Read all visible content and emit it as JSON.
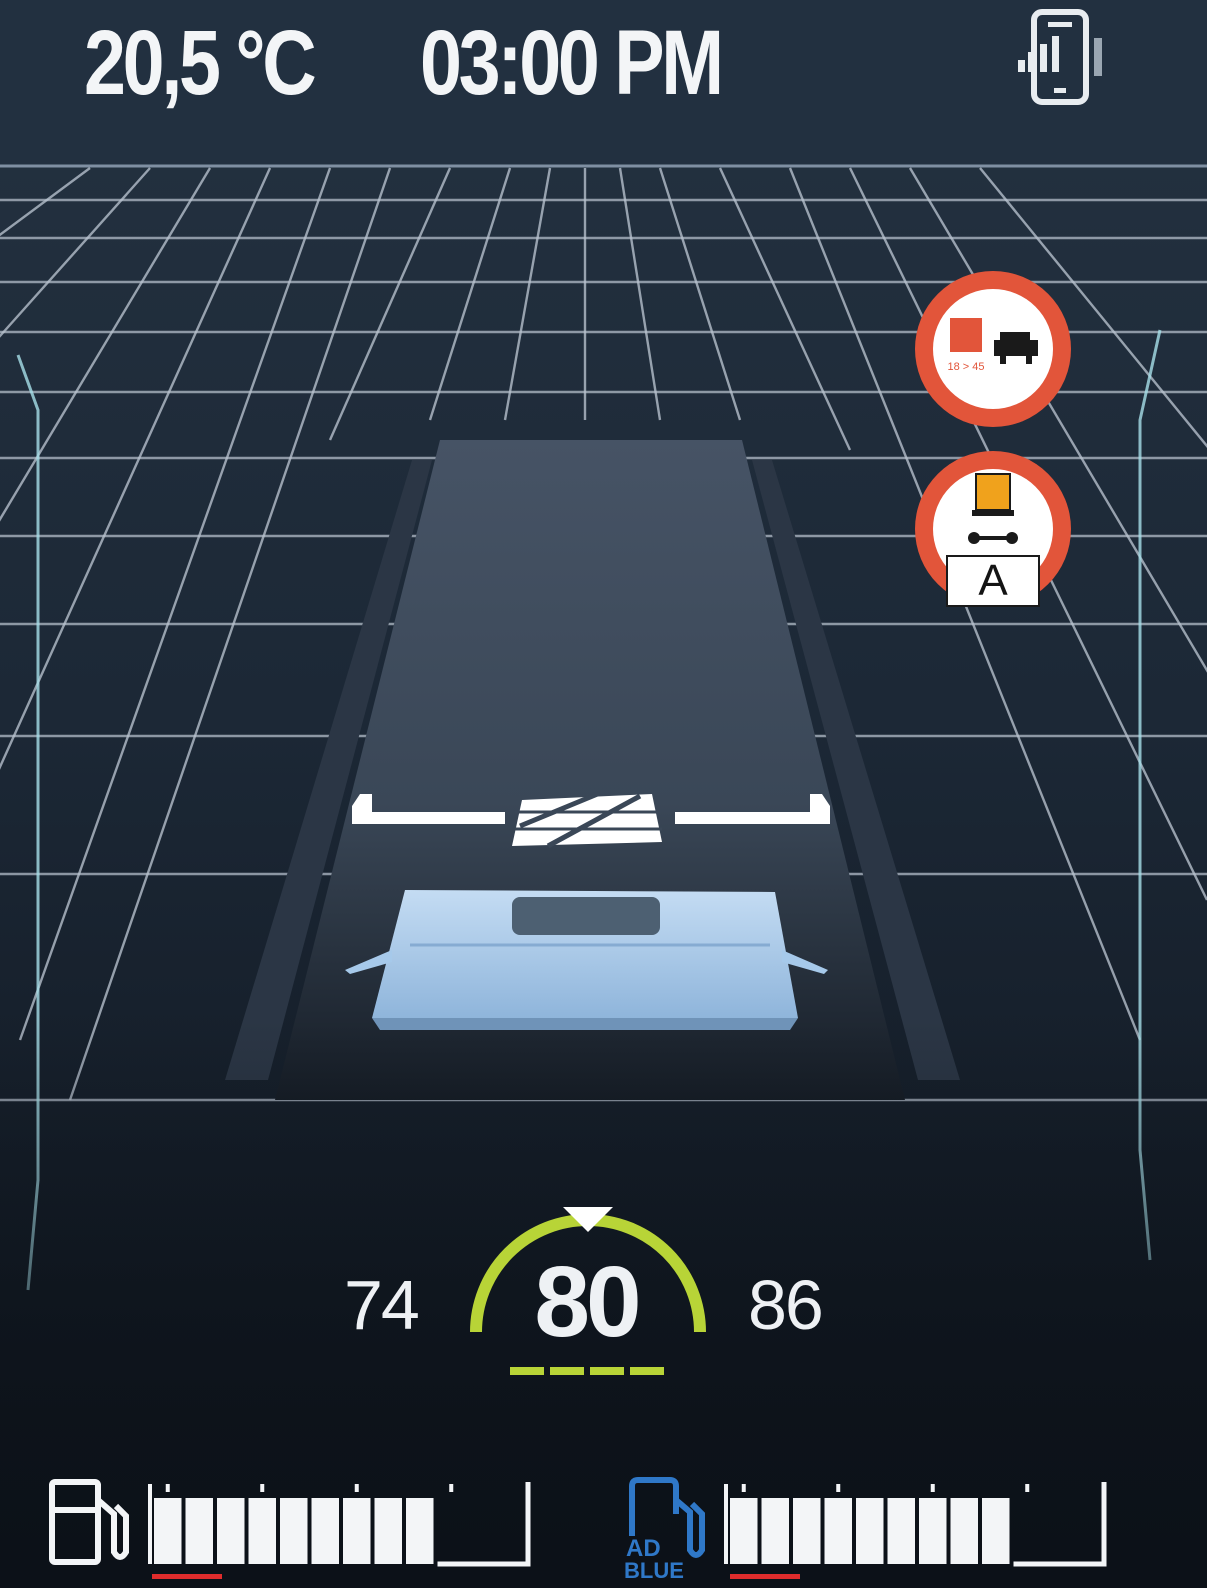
{
  "status_bar": {
    "temperature": "20,5 °C",
    "time": "03:00 PM",
    "connectivity_icon": "phone-signal-icon"
  },
  "traffic_signs": {
    "no_overtaking_trucks": {
      "icon": "no-overtaking-trucks-sign-icon",
      "caption": "18 > 45"
    },
    "dangerous_goods": {
      "icon": "no-dangerous-goods-sign-icon",
      "plate": "A"
    }
  },
  "cruise_control": {
    "lower_limit": "74",
    "set_speed": "80",
    "upper_limit": "86",
    "arc_color": "#b8d437"
  },
  "gauges": {
    "fuel": {
      "icon": "fuel-pump-icon",
      "level": 0.8,
      "segments": 12,
      "filled_segments": 9,
      "warning_color": "#e02c2c"
    },
    "adblue": {
      "icon": "adblue-icon",
      "icon_text": "AD BLUE",
      "level": 0.8,
      "segments": 12,
      "filled_segments": 9,
      "warning_color": "#e02c2c"
    }
  },
  "colors": {
    "sign_red": "#e2553a",
    "adblue_blue": "#2f78c8",
    "grid_line": "#b9c3cf",
    "road": "#3a4655",
    "truck_cab": "#a6c9ea"
  }
}
